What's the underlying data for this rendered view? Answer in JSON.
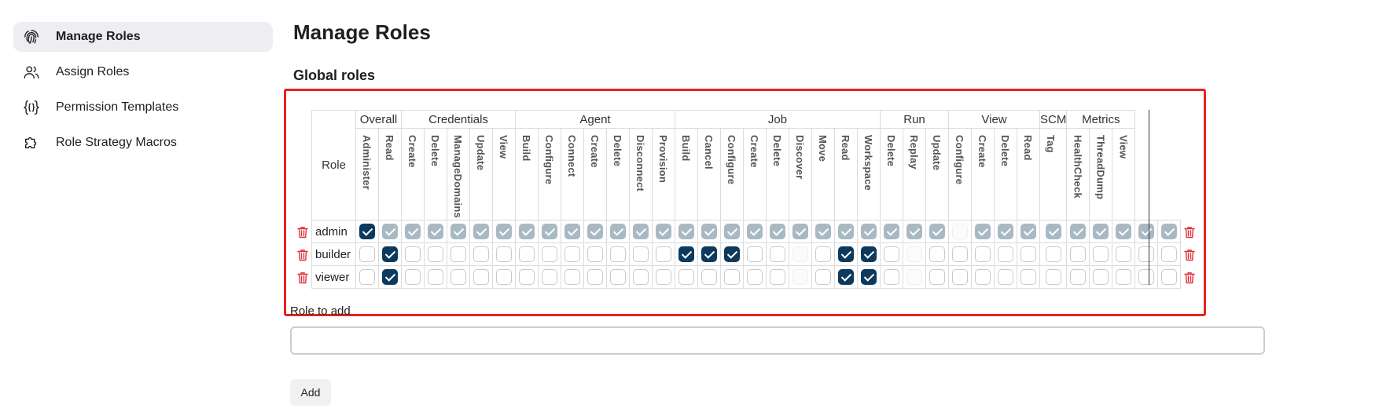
{
  "sidebar": {
    "items": [
      {
        "label": "Manage Roles",
        "icon": "fingerprint-icon",
        "active": true
      },
      {
        "label": "Assign Roles",
        "icon": "users-icon",
        "active": false
      },
      {
        "label": "Permission Templates",
        "icon": "braces-icon",
        "active": false
      },
      {
        "label": "Role Strategy Macros",
        "icon": "puzzle-icon",
        "active": false
      }
    ]
  },
  "main": {
    "title": "Manage Roles",
    "subtitle": "Global roles",
    "role_header": "Role",
    "groups": [
      {
        "name": "Overall",
        "perms": [
          "Administer",
          "Read"
        ]
      },
      {
        "name": "Credentials",
        "perms": [
          "Create",
          "Delete",
          "ManageDomains",
          "Update",
          "View"
        ]
      },
      {
        "name": "Agent",
        "perms": [
          "Build",
          "Configure",
          "Connect",
          "Create",
          "Delete",
          "Disconnect",
          "Provision"
        ]
      },
      {
        "name": "Job",
        "perms": [
          "Build",
          "Cancel",
          "Configure",
          "Create",
          "Delete",
          "Discover",
          "Move",
          "Read",
          "Workspace"
        ]
      },
      {
        "name": "Run",
        "perms": [
          "Delete",
          "Replay",
          "Update"
        ]
      },
      {
        "name": "View",
        "perms": [
          "Configure",
          "Create",
          "Delete",
          "Read"
        ]
      },
      {
        "name": "SCM",
        "perms": [
          "Tag"
        ]
      },
      {
        "name": "Metrics",
        "perms": [
          "HealthCheck",
          "ThreadDump",
          "View"
        ]
      }
    ],
    "roles": [
      {
        "name": "admin",
        "states": "CIIIIIIIIIIIIIIIIIIIIIIIIIDIIIIIIIII"
      },
      {
        "name": "builder",
        "states": "UCUUUUUUUUUUUUCCCUUDUCCUDUUUUUUUUUUU"
      },
      {
        "name": "viewer",
        "states": "UCUUUUUUUUUUUUUUUUUDUCCUDUUUUUUUUUUU"
      }
    ],
    "state_legend": {
      "C": "checked",
      "I": "implied",
      "U": "unchecked",
      "D": "disabled"
    },
    "role_to_add_label": "Role to add",
    "role_to_add_value": "",
    "add_button": "Add"
  },
  "colors": {
    "checked": "#0d3a5c",
    "implied": "#a9b9c4",
    "frame": "#e8231d",
    "trash": "#e0303a",
    "active_item_bg": "#eeeef2"
  }
}
